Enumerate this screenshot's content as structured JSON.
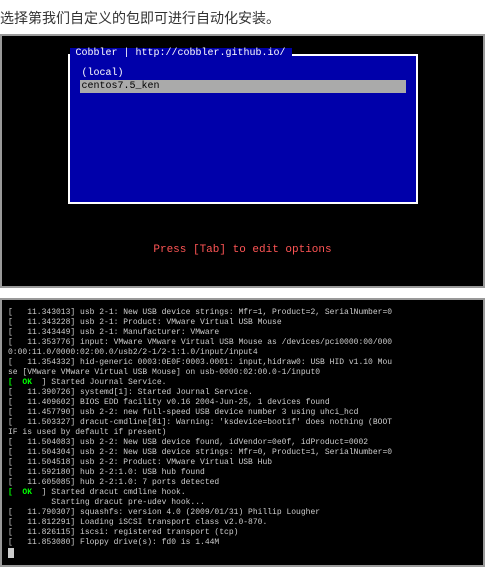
{
  "heading": "选择第我们自定义的包即可进行自动化安装。",
  "cobbler": {
    "title_prefix": "Cobbler | ",
    "title_url": "http://cobbler.github.io/",
    "menu_items": [
      {
        "label": "(local)",
        "selected": false
      },
      {
        "label": "centos7.5_ken",
        "selected": true
      }
    ],
    "hint": "Press [Tab] to edit options"
  },
  "dmesg": {
    "lines": [
      {
        "t": "[   11.343013] usb 2-1: New USB device strings: Mfr=1, Product=2, SerialNumber=0"
      },
      {
        "t": "[   11.343228] usb 2-1: Product: VMware Virtual USB Mouse"
      },
      {
        "t": "[   11.343449] usb 2-1: Manufacturer: VMware"
      },
      {
        "t": "[   11.353776] input: VMware VMware Virtual USB Mouse as /devices/pci0000:00/000"
      },
      {
        "t": "0:00:11.0/0000:02:00.0/usb2/2-1/2-1:1.0/input/input4"
      },
      {
        "t": "[   11.354332] hid-generic 0003:0E0F:0003.0001: input,hidraw0: USB HID v1.10 Mou"
      },
      {
        "t": "se [VMware VMware Virtual USB Mouse] on usb-0000:02:00.0-1/input0"
      },
      {
        "ok": true,
        "t": "] Started Journal Service."
      },
      {
        "t": "[   11.390726] systemd[1]: Started Journal Service."
      },
      {
        "t": "[   11.409602] BIOS EDD facility v0.16 2004-Jun-25, 1 devices found"
      },
      {
        "t": "[   11.457790] usb 2-2: new full-speed USB device number 3 using uhci_hcd"
      },
      {
        "t": "[   11.503327] dracut-cmdline[81]: Warning: 'ksdevice=bootif' does nothing (BOOT"
      },
      {
        "t": "IF is used by default if present)"
      },
      {
        "t": "[   11.504083] usb 2-2: New USB device found, idVendor=0e0f, idProduct=0002"
      },
      {
        "t": "[   11.504304] usb 2-2: New USB device strings: Mfr=0, Product=1, SerialNumber=0"
      },
      {
        "t": "[   11.504518] usb 2-2: Product: VMware Virtual USB Hub"
      },
      {
        "t": "[   11.592180] hub 2-2:1.0: USB hub found"
      },
      {
        "t": "[   11.605085] hub 2-2:1.0: 7 ports detected"
      },
      {
        "ok": true,
        "t": "] Started dracut cmdline hook."
      },
      {
        "t": "         Starting dracut pre-udev hook..."
      },
      {
        "t": "[   11.790307] squashfs: version 4.0 (2009/01/31) Phillip Lougher"
      },
      {
        "t": "[   11.812291] Loading iSCSI transport class v2.0-870."
      },
      {
        "t": "[   11.826115] iscsi: registered transport (tcp)"
      },
      {
        "t": "[   11.853080] Floppy drive(s): fd0 is 1.44M"
      }
    ],
    "ok_prefix": "[  OK  "
  }
}
